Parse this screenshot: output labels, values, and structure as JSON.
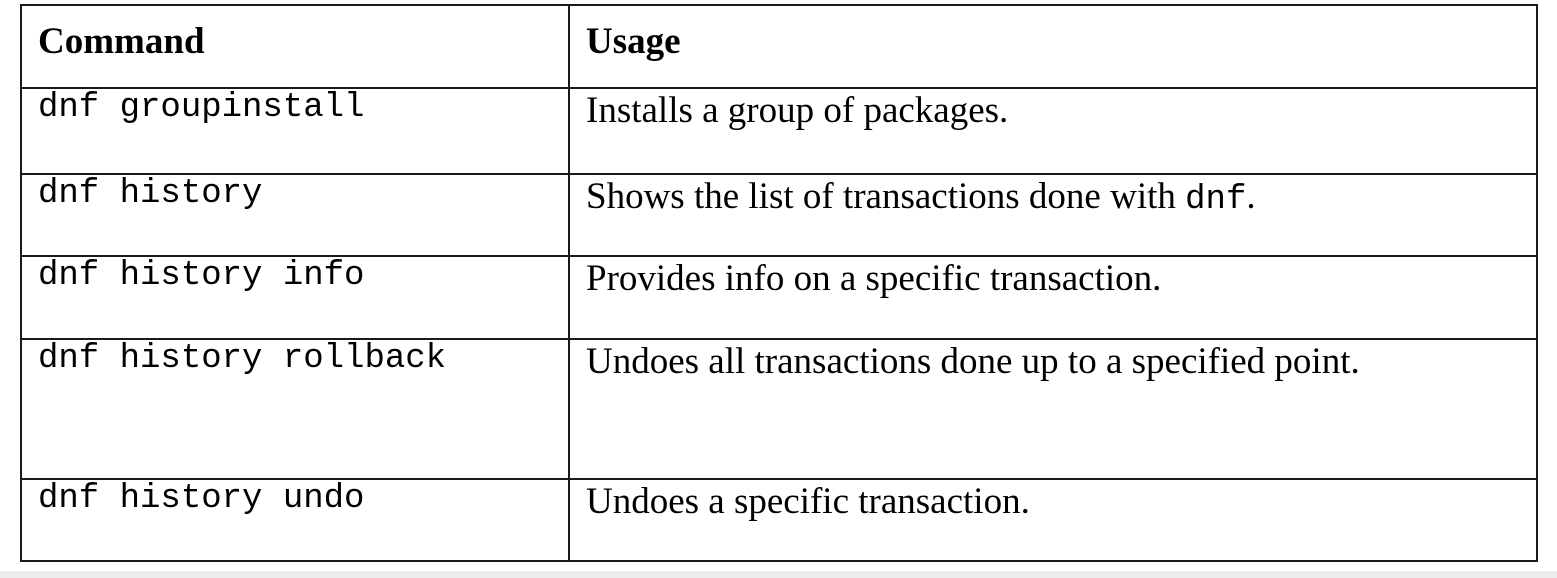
{
  "table": {
    "headers": {
      "command": "Command",
      "usage": "Usage"
    },
    "rows": [
      {
        "command": "dnf groupinstall",
        "usage": "Installs a group of packages.",
        "usage_code": "",
        "usage_end": ""
      },
      {
        "command": "dnf history",
        "usage": "Shows the list of transactions done with ",
        "usage_code": "dnf",
        "usage_end": "."
      },
      {
        "command": "dnf history info",
        "usage": "Provides info on a specific transaction.",
        "usage_code": "",
        "usage_end": ""
      },
      {
        "command": "dnf history rollback",
        "usage": "Undoes all transactions done up to a specified point.",
        "usage_code": "",
        "usage_end": ""
      },
      {
        "command": "dnf history undo",
        "usage": "Undoes a specific transaction.",
        "usage_code": "",
        "usage_end": ""
      }
    ]
  }
}
